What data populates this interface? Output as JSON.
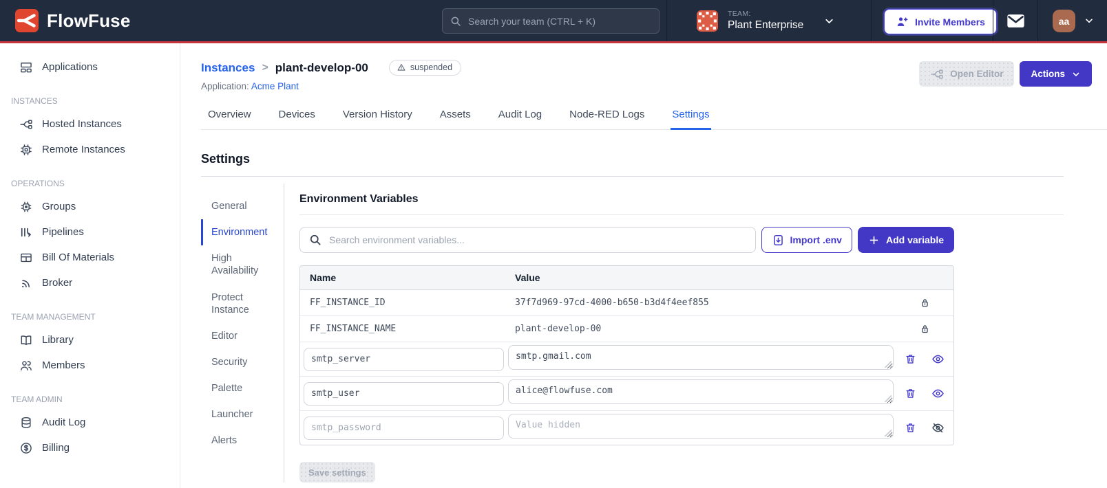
{
  "colors": {
    "header_bg": "#212c3e",
    "brand_red": "#e0452f",
    "header_rule_red": "#c9353c",
    "accent_indigo": "#4338ca",
    "link_blue": "#2563eb",
    "nav_active_blue": "#2946d2",
    "avatar_brown": "#a96a50",
    "identicon_orange": "#dd5c45"
  },
  "header": {
    "brand": "FlowFuse",
    "search_placeholder": "Search your team (CTRL + K)",
    "team_label": "TEAM:",
    "team_name": "Plant Enterprise",
    "invite_button": "Invite Members",
    "avatar_initials": "aa"
  },
  "sidebar": {
    "applications": "Applications",
    "sections": [
      {
        "label": "INSTANCES",
        "items": [
          "Hosted Instances",
          "Remote Instances"
        ]
      },
      {
        "label": "OPERATIONS",
        "items": [
          "Groups",
          "Pipelines",
          "Bill Of Materials",
          "Broker"
        ]
      },
      {
        "label": "TEAM MANAGEMENT",
        "items": [
          "Library",
          "Members"
        ]
      },
      {
        "label": "TEAM ADMIN",
        "items": [
          "Audit Log",
          "Billing"
        ]
      }
    ]
  },
  "page": {
    "breadcrumb_parent": "Instances",
    "breadcrumb_separator": ">",
    "breadcrumb_current": "plant-develop-00",
    "status_badge": "suspended",
    "application_label": "Application:",
    "application_name": "Acme Plant",
    "open_editor_button": "Open Editor",
    "actions_button": "Actions",
    "tabs": [
      "Overview",
      "Devices",
      "Version History",
      "Assets",
      "Audit Log",
      "Node-RED Logs",
      "Settings"
    ],
    "active_tab": "Settings"
  },
  "settings": {
    "title": "Settings",
    "nav": [
      "General",
      "Environment",
      "High Availability",
      "Protect Instance",
      "Editor",
      "Security",
      "Palette",
      "Launcher",
      "Alerts"
    ],
    "active_nav": "Environment",
    "section_title": "Environment Variables",
    "search_placeholder": "Search environment variables...",
    "import_button": "Import .env",
    "add_button": "Add variable",
    "columns": {
      "name": "Name",
      "value": "Value"
    },
    "locked_rows": [
      {
        "name": "FF_INSTANCE_ID",
        "value": "37f7d969-97cd-4000-b650-b3d4f4eef855"
      },
      {
        "name": "FF_INSTANCE_NAME",
        "value": "plant-develop-00"
      }
    ],
    "editable_rows": [
      {
        "name": "smtp_server",
        "value": "smtp.gmail.com",
        "hidden": false
      },
      {
        "name": "smtp_user",
        "value": "alice@flowfuse.com",
        "hidden": false
      },
      {
        "name": "smtp_password",
        "value": "",
        "value_placeholder": "Value hidden",
        "hidden": true
      }
    ],
    "save_button": "Save settings"
  }
}
